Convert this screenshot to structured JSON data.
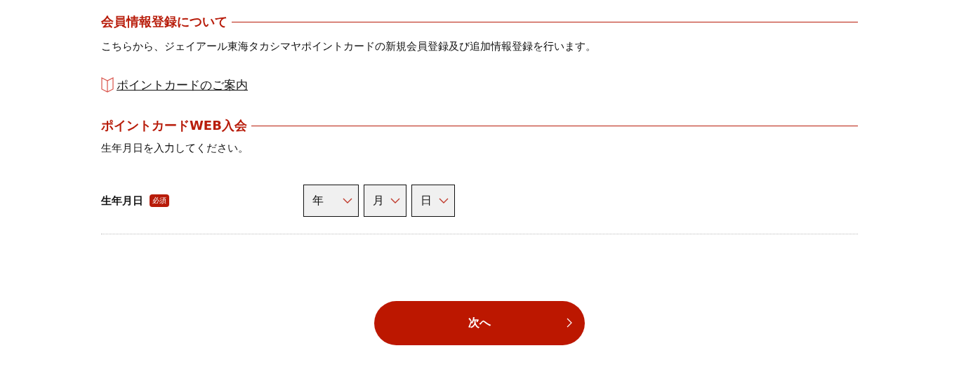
{
  "sections": [
    {
      "heading": "会員情報登録について",
      "text": "こちらから、ジェイアール東海タカシマヤポイントカードの新規会員登録及び追加情報登録を行います。",
      "link": "ポイントカードのご案内"
    },
    {
      "heading": "ポイントカードWEB入会",
      "text": "生年月日を入力してください。"
    }
  ],
  "form": {
    "label": "生年月日",
    "required_badge": "必須",
    "selects": [
      {
        "placeholder": "年"
      },
      {
        "placeholder": "月"
      },
      {
        "placeholder": "日"
      }
    ]
  },
  "next_button": "次へ"
}
